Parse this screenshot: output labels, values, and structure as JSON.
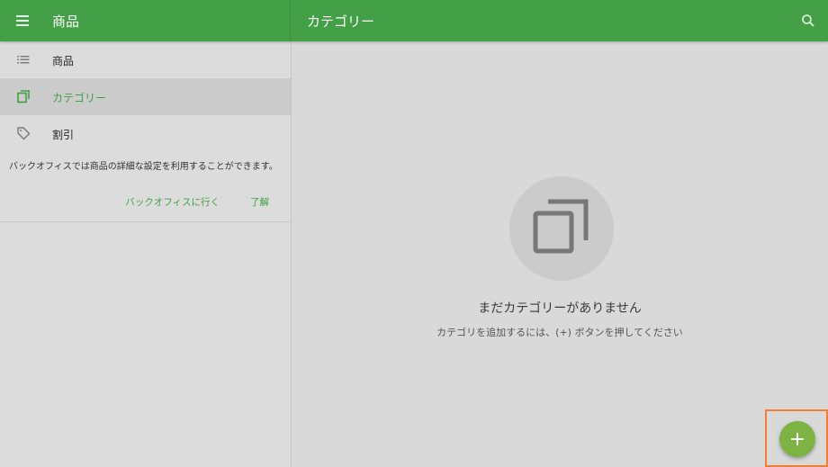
{
  "app": {
    "title": "商品"
  },
  "header": {
    "section_title": "カテゴリー"
  },
  "sidebar": {
    "items": [
      {
        "label": "商品",
        "icon": "list-icon"
      },
      {
        "label": "カテゴリー",
        "icon": "copy-icon",
        "active": true
      },
      {
        "label": "割引",
        "icon": "tag-icon"
      }
    ],
    "notice": {
      "text": "バックオフィスでは商品の詳細な設定を利用することができます。",
      "go_label": "バックオフィスに行く",
      "ok_label": "了解"
    }
  },
  "main": {
    "empty_title": "まだカテゴリーがありません",
    "empty_subtitle": "カテゴリを追加するには、(+) ボタンを押してください"
  },
  "fab": {
    "label": "+"
  },
  "colors": {
    "accent": "#43a047",
    "fab": "#7cb342",
    "highlight": "#f47e2c"
  }
}
